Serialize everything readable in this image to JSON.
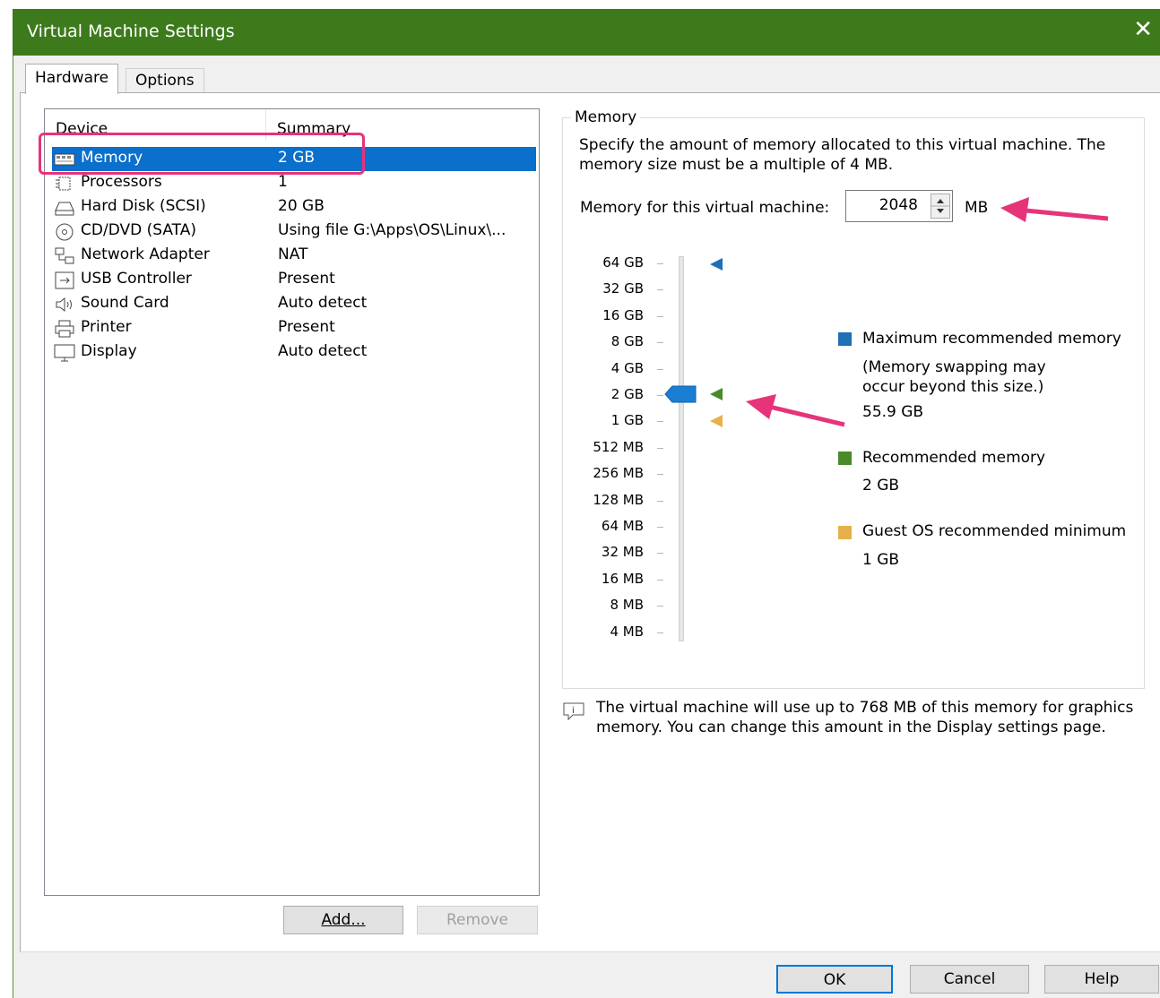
{
  "window": {
    "title": "Virtual Machine Settings",
    "close_glyph": "✕"
  },
  "tabs": [
    {
      "label": "Hardware",
      "active": true
    },
    {
      "label": "Options",
      "active": false
    }
  ],
  "device_list": {
    "columns": [
      "Device",
      "Summary"
    ],
    "rows": [
      {
        "icon": "memory-icon",
        "name": "Memory",
        "summary": "2 GB",
        "selected": true
      },
      {
        "icon": "processor-icon",
        "name": "Processors",
        "summary": "1"
      },
      {
        "icon": "hard-disk-icon",
        "name": "Hard Disk (SCSI)",
        "summary": "20 GB"
      },
      {
        "icon": "cd-dvd-icon",
        "name": "CD/DVD (SATA)",
        "summary": "Using file G:\\Apps\\OS\\Linux\\..."
      },
      {
        "icon": "network-adapter-icon",
        "name": "Network Adapter",
        "summary": "NAT"
      },
      {
        "icon": "usb-icon",
        "name": "USB Controller",
        "summary": "Present"
      },
      {
        "icon": "sound-icon",
        "name": "Sound Card",
        "summary": "Auto detect"
      },
      {
        "icon": "printer-icon",
        "name": "Printer",
        "summary": "Present"
      },
      {
        "icon": "display-icon",
        "name": "Display",
        "summary": "Auto detect"
      }
    ],
    "add_label": "Add...",
    "remove_label": "Remove"
  },
  "memory": {
    "group_title": "Memory",
    "description": "Specify the amount of memory allocated to this virtual machine. The memory size must be a multiple of 4 MB.",
    "field_label": "Memory for this virtual machine:",
    "value": "2048",
    "unit": "MB",
    "scale_labels": [
      "64 GB",
      "32 GB",
      "16 GB",
      "8 GB",
      "4 GB",
      "2 GB",
      "1 GB",
      "512 MB",
      "256 MB",
      "128 MB",
      "64 MB",
      "32 MB",
      "16 MB",
      "8 MB",
      "4 MB"
    ],
    "slider_value": "2 GB",
    "legend": {
      "max": {
        "label": "Maximum recommended memory",
        "note": "(Memory swapping may occur beyond this size.)",
        "value": "55.9 GB",
        "color": "#1f6fb7"
      },
      "recommended": {
        "label": "Recommended memory",
        "value": "2 GB",
        "color": "#4a8a2a"
      },
      "guest_min": {
        "label": "Guest OS recommended minimum",
        "value": "1 GB",
        "color": "#e8b04a"
      }
    },
    "graphics_note": "The virtual machine will use up to 768 MB of this memory for graphics memory. You can change this amount in the Display settings page."
  },
  "buttons": {
    "ok": "OK",
    "cancel": "Cancel",
    "help": "Help"
  },
  "colors": {
    "titlebar": "#3d7a1c",
    "selection": "#0b6fcc",
    "annotation": "#e6337a"
  }
}
